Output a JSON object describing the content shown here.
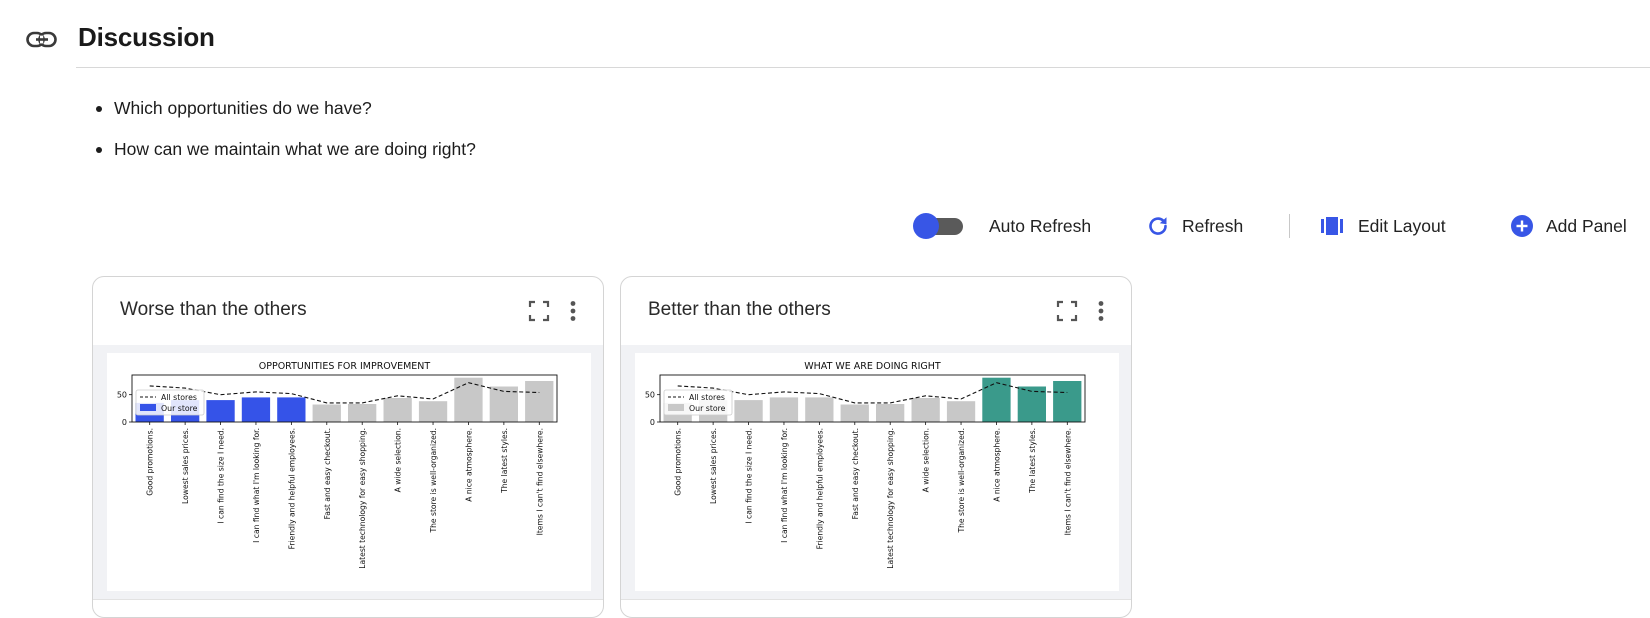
{
  "section": {
    "title": "Discussion",
    "link_icon": "link-icon"
  },
  "bullets": [
    "Which opportunities do we have?",
    "How can we maintain what we are doing right?"
  ],
  "toolbar": {
    "auto_refresh_label": "Auto Refresh",
    "auto_refresh_on": true,
    "refresh_label": "Refresh",
    "edit_layout_label": "Edit Layout",
    "add_panel_label": "Add Panel",
    "accent_color": "#3856e6"
  },
  "panels": [
    {
      "title": "Worse than the others",
      "chart_data": {
        "type": "bar",
        "title": "OPPORTUNITIES FOR IMPROVEMENT",
        "categories": [
          "Good promotions.",
          "Lowest sales prices.",
          "I can find the size I need.",
          "I can find what I'm looking for.",
          "Friendly and helpful employees.",
          "Fast and easy checkout.",
          "Latest technology for easy shopping.",
          "A wide selection.",
          "The store is well-organized.",
          "A nice atmosphere.",
          "The latest styles.",
          "Items I can't find elsewhere."
        ],
        "yticks": [
          0,
          50
        ],
        "ylim": [
          0,
          86
        ],
        "legend": [
          "All stores",
          "Our store"
        ],
        "legend_position": "left",
        "series": [
          {
            "name": "Our store",
            "values": [
              35,
              40,
              40,
              45,
              45,
              32,
              33,
              44,
              38,
              81,
              65,
              75
            ]
          },
          {
            "name": "All stores",
            "values": [
              66,
              62,
              50,
              55,
              52,
              35,
              35,
              48,
              42,
              72,
              56,
              54
            ]
          }
        ],
        "highlight": [
          0,
          1,
          2,
          3,
          4
        ],
        "highlight_color": "#3553e8",
        "base_color": "#c8c8c8",
        "line_color": "#111111"
      }
    },
    {
      "title": "Better than the others",
      "chart_data": {
        "type": "bar",
        "title": "WHAT WE ARE DOING RIGHT",
        "categories": [
          "Good promotions.",
          "Lowest sales prices.",
          "I can find the size I need.",
          "I can find what I'm looking for.",
          "Friendly and helpful employees.",
          "Fast and easy checkout.",
          "Latest technology for easy shopping.",
          "A wide selection.",
          "The store is well-organized.",
          "A nice atmosphere.",
          "The latest styles.",
          "Items I can't find elsewhere."
        ],
        "yticks": [
          0,
          50
        ],
        "ylim": [
          0,
          86
        ],
        "legend": [
          "All stores",
          "Our store"
        ],
        "legend_position": "left",
        "series": [
          {
            "name": "Our store",
            "values": [
              35,
              40,
              40,
              45,
              45,
              32,
              33,
              44,
              38,
              81,
              65,
              75
            ]
          },
          {
            "name": "All stores",
            "values": [
              66,
              62,
              50,
              55,
              52,
              35,
              35,
              48,
              42,
              72,
              56,
              54
            ]
          }
        ],
        "highlight": [
          9,
          10,
          11
        ],
        "highlight_color": "#3a9a8b",
        "base_color": "#c8c8c8",
        "line_color": "#111111"
      }
    }
  ]
}
